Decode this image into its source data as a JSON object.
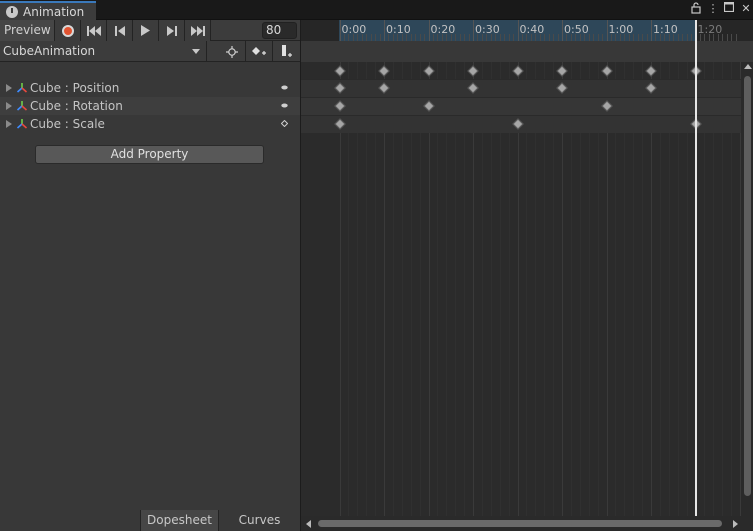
{
  "window": {
    "tab_title": "Animation",
    "buttons": [
      "lock-icon",
      "more-icon",
      "maximize-icon",
      "close-icon"
    ]
  },
  "toolbar": {
    "preview_label": "Preview",
    "frame_value": "80",
    "clip_name": "CubeAnimation",
    "add_property_label": "Add Property"
  },
  "properties": [
    {
      "label": "Cube : Position"
    },
    {
      "label": "Cube : Rotation"
    },
    {
      "label": "Cube : Scale"
    }
  ],
  "bottom_tabs": {
    "dopesheet": "Dopesheet",
    "curves": "Curves"
  },
  "timeline": {
    "time_labels": [
      "0:00",
      "0:10",
      "0:20",
      "0:30",
      "0:40",
      "0:50",
      "1:00",
      "1:10",
      "1:20"
    ],
    "playhead_frame": 80,
    "keyframes": {
      "summary": [
        0,
        10,
        20,
        30,
        40,
        50,
        60,
        70,
        80
      ],
      "position": [
        0,
        10,
        30,
        50,
        70
      ],
      "rotation": [
        0,
        20,
        60
      ],
      "scale": [
        0,
        40,
        80
      ]
    }
  },
  "colors": {
    "record": "#e25432",
    "accent_tab": "#3a79bb",
    "ruler_active": "#2e4759"
  }
}
